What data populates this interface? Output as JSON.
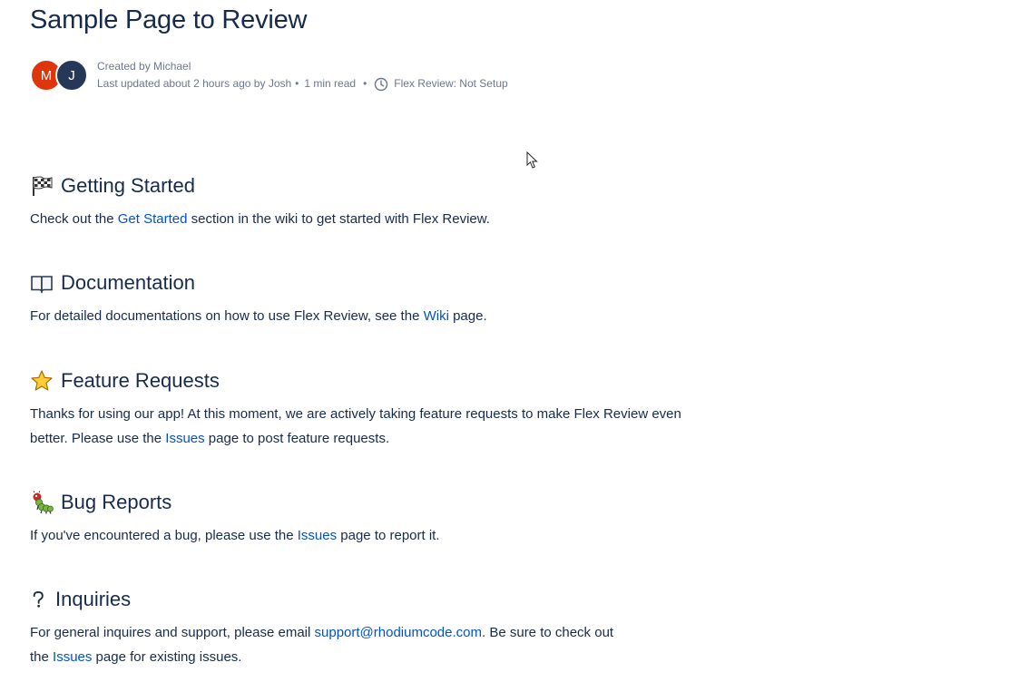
{
  "page": {
    "title": "Sample Page to Review"
  },
  "byline": {
    "avatars": [
      {
        "initial": "M",
        "color": "#de350b"
      },
      {
        "initial": "J",
        "color": "#253858"
      }
    ],
    "created": "Created by Michael",
    "updated": "Last updated about 2 hours ago by Josh",
    "read_time": "1 min read",
    "flex_status": "Flex Review: Not Setup"
  },
  "sections": {
    "getting_started": {
      "icon": "checkered-flag-icon",
      "heading": "Getting Started",
      "pre": "Check out the ",
      "link": "Get Started",
      "post": " section in the wiki to get started with Flex Review."
    },
    "documentation": {
      "icon": "open-book-icon",
      "heading": "Documentation",
      "pre": "For detailed documentations on how to use Flex Review, see the ",
      "link": "Wiki",
      "post": " page."
    },
    "feature_requests": {
      "icon": "star-icon",
      "heading": "Feature Requests",
      "line1": "Thanks for using our app! At this moment, we are actively taking feature requests to make Flex Review even",
      "pre": "better. Please use the ",
      "link": "Issues",
      "post": " page to post feature requests."
    },
    "bug_reports": {
      "icon": "bug-icon",
      "heading": "Bug Reports",
      "pre": "If you've encountered a bug, please use the ",
      "link": "Issues",
      "post": " page to report it."
    },
    "inquiries": {
      "icon": "question-mark-icon",
      "heading": "Inquiries",
      "pre": "For general inquires and support, please email ",
      "email": "support@rhodiumcode.com",
      "mid": ". Be sure to check out",
      "pre2": "the ",
      "link": "Issues",
      "post": " page for existing issues."
    }
  },
  "colors": {
    "text": "#172b4d",
    "link": "#0052cc",
    "meta": "#6b778c"
  }
}
